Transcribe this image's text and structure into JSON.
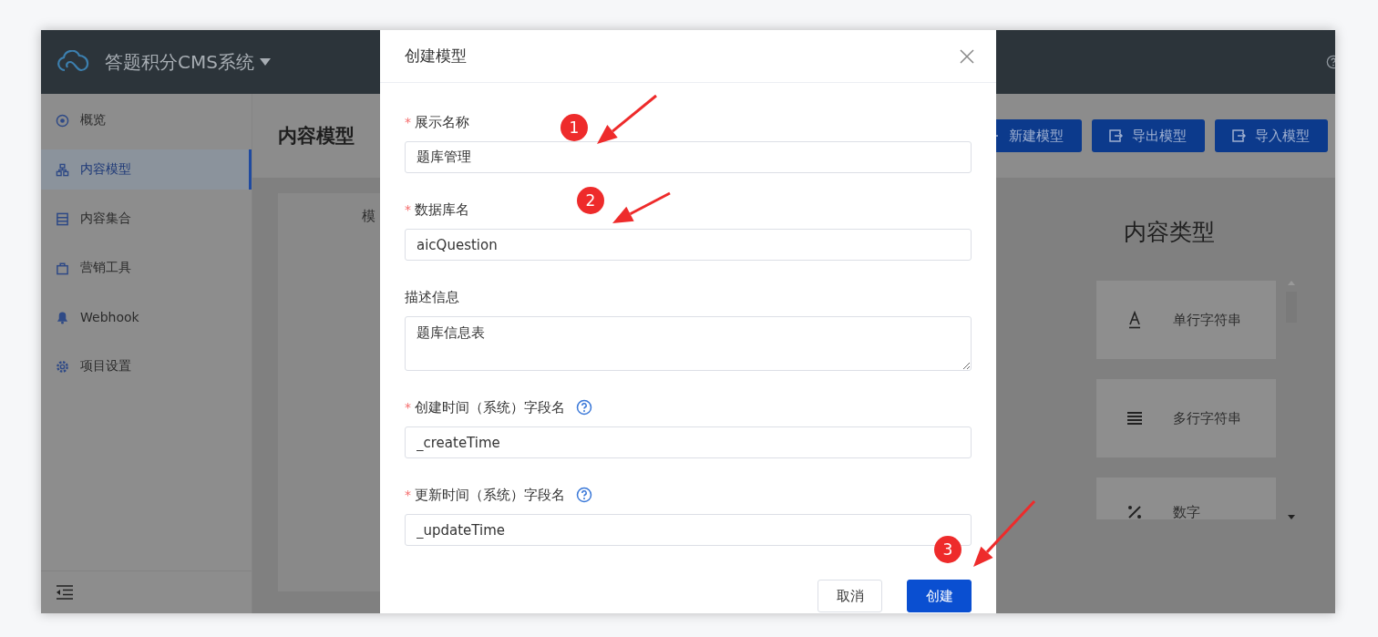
{
  "header": {
    "app_title": "答题积分CMS系统"
  },
  "sidebar": {
    "items": [
      {
        "label": "概览",
        "selected": false
      },
      {
        "label": "内容模型",
        "selected": true
      },
      {
        "label": "内容集合",
        "selected": false
      },
      {
        "label": "营销工具",
        "selected": false
      },
      {
        "label": "Webhook",
        "selected": false
      },
      {
        "label": "项目设置",
        "selected": false
      }
    ]
  },
  "page": {
    "title": "内容模型",
    "actions": [
      {
        "label": "新建模型",
        "kind": "new"
      },
      {
        "label": "导出模型",
        "kind": "export"
      },
      {
        "label": "导入模型",
        "kind": "import"
      }
    ],
    "panel_label": "模",
    "types": {
      "title": "内容类型",
      "items": [
        {
          "label": "单行字符串",
          "kind": "single"
        },
        {
          "label": "多行字符串",
          "kind": "multi"
        },
        {
          "label": "数字",
          "kind": "number"
        }
      ]
    }
  },
  "dialog": {
    "title": "创建模型",
    "fields": [
      {
        "label": "展示名称",
        "marker": "*",
        "help": false,
        "kind": "input",
        "value": "题库管理"
      },
      {
        "label": "数据库名",
        "marker": "*",
        "help": false,
        "kind": "input",
        "value": "aicQuestion"
      },
      {
        "label": "描述信息",
        "help": false,
        "kind": "textarea",
        "value": "题库信息表"
      },
      {
        "label": "创建时间（系统）字段名",
        "marker": "*",
        "help": true,
        "kind": "input",
        "value": "_createTime"
      },
      {
        "label": "更新时间（系统）字段名",
        "marker": "*",
        "help": true,
        "kind": "input",
        "value": "_updateTime"
      }
    ],
    "buttons": [
      {
        "label": "取消",
        "primary": false
      },
      {
        "label": "创建",
        "primary": true
      }
    ]
  },
  "annotations": [
    {
      "number": "1"
    },
    {
      "number": "2"
    },
    {
      "number": "3"
    }
  ]
}
